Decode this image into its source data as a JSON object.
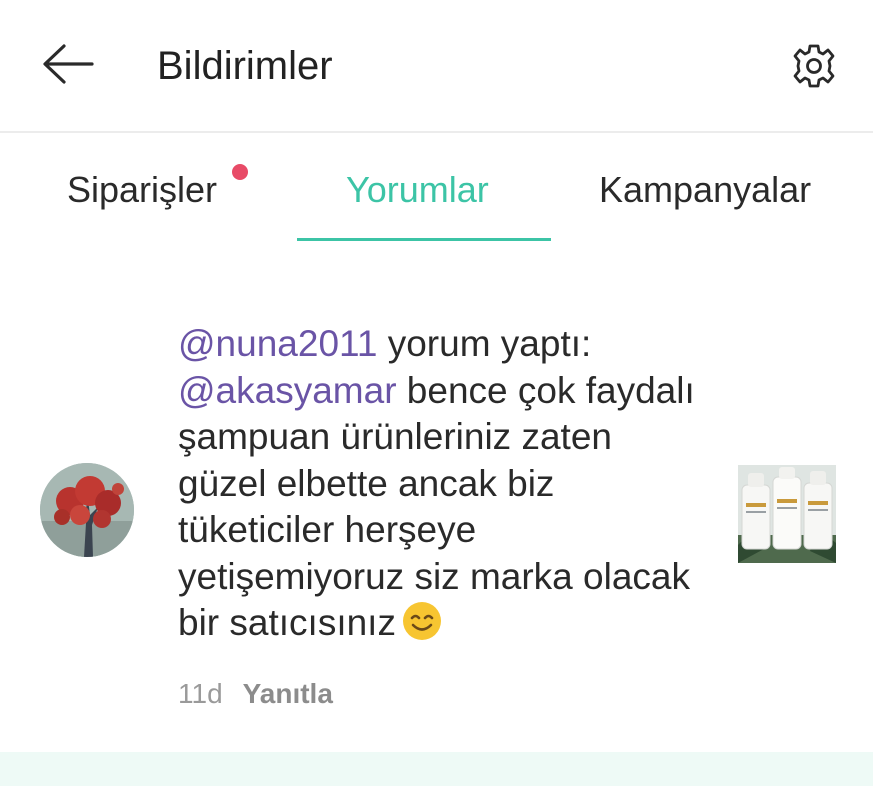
{
  "header": {
    "title": "Bildirimler",
    "back_icon": "arrow-left-icon",
    "settings_icon": "gear-icon"
  },
  "tabs": [
    {
      "label": "Siparişler",
      "has_badge": true
    },
    {
      "label": "Yorumlar",
      "active": true
    },
    {
      "label": "Kampanyalar"
    }
  ],
  "notification": {
    "author": "@nuna2011",
    "action": " yorum yaptı:",
    "mention": "@akasyamar",
    "text_line1": " bence çok",
    "text_rest": "faydalı şampuan ürünleriniz zaten güzel elbette ancak biz tüketiciler herşeye yetişemiyoruz siz marka olacak bir satıcısınız",
    "emoji": "smiling-face-icon",
    "time": "11d",
    "reply_label": "Yanıtla"
  },
  "colors": {
    "accent": "#3cc4a6",
    "mention": "#6a54a6",
    "badge": "#e84b67"
  }
}
